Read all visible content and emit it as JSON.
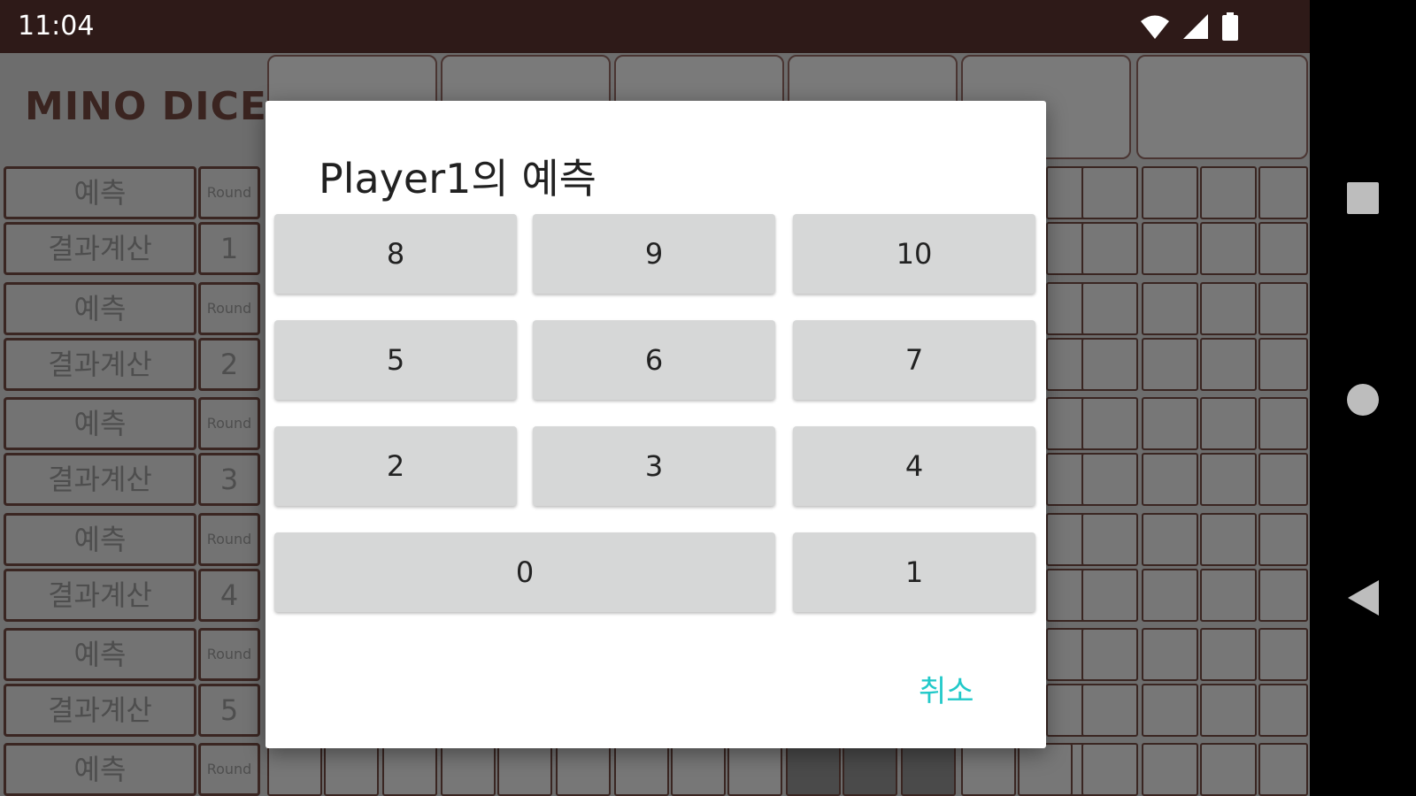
{
  "status_bar": {
    "time": "11:04"
  },
  "app": {
    "title": "MINO DICE",
    "rows": [
      {
        "label": "예측",
        "tag": "Round"
      },
      {
        "label": "결과계산",
        "tag": "1"
      },
      {
        "label": "예측",
        "tag": "Round"
      },
      {
        "label": "결과계산",
        "tag": "2"
      },
      {
        "label": "예측",
        "tag": "Round"
      },
      {
        "label": "결과계산",
        "tag": "3"
      },
      {
        "label": "예측",
        "tag": "Round"
      },
      {
        "label": "결과계산",
        "tag": "4"
      },
      {
        "label": "예측",
        "tag": "Round"
      },
      {
        "label": "결과계산",
        "tag": "5"
      },
      {
        "label": "예측",
        "tag": "Round"
      }
    ]
  },
  "dialog": {
    "title": "Player1의 예측",
    "buttons": [
      "8",
      "9",
      "10",
      "5",
      "6",
      "7",
      "2",
      "3",
      "4",
      "0",
      "1"
    ],
    "cancel_label": "취소",
    "cancel_color": "#22c9c9"
  },
  "colors": {
    "frame": "#2e1a18",
    "board": "#6d6d6d",
    "button": "#d6d7d7"
  }
}
